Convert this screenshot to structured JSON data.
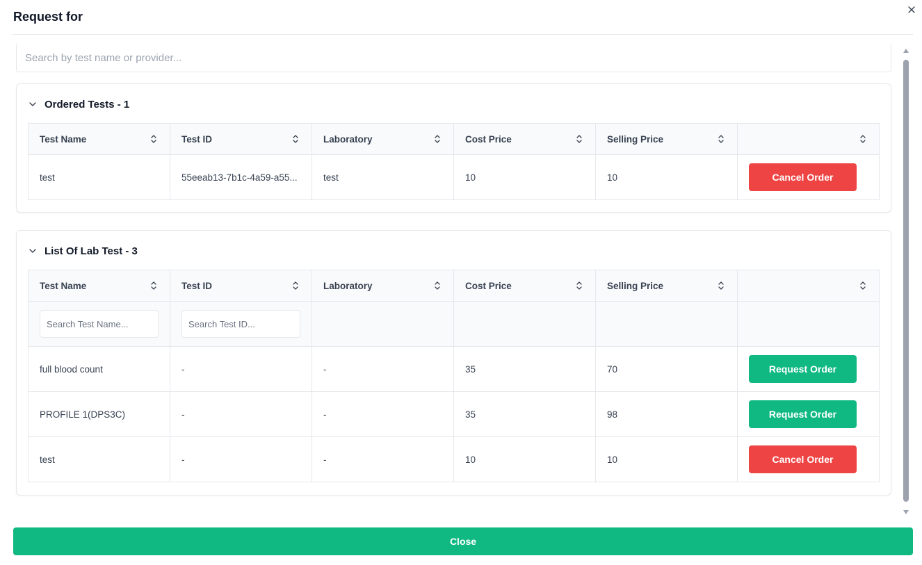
{
  "modal": {
    "title": "Request for",
    "close_label": "Close"
  },
  "search": {
    "placeholder": "Search by test name or provider..."
  },
  "colors": {
    "cancel": "#ef4444",
    "request": "#10b981",
    "close_button": "#10b981"
  },
  "ordered_tests": {
    "title": "Ordered Tests - 1",
    "columns": [
      "Test Name",
      "Test ID",
      "Laboratory",
      "Cost Price",
      "Selling Price",
      ""
    ],
    "rows": [
      {
        "test_name": "test",
        "test_id": "55eeab13-7b1c-4a59-a55...",
        "laboratory": "test",
        "cost_price": "10",
        "selling_price": "10",
        "action": "Cancel Order"
      }
    ]
  },
  "lab_tests": {
    "title": "List Of Lab Test - 3",
    "columns": [
      "Test Name",
      "Test ID",
      "Laboratory",
      "Cost Price",
      "Selling Price",
      ""
    ],
    "filters": {
      "test_name_placeholder": "Search Test Name...",
      "test_id_placeholder": "Search Test ID..."
    },
    "rows": [
      {
        "test_name": "full blood count",
        "test_id": "-",
        "laboratory": "-",
        "cost_price": "35",
        "selling_price": "70",
        "action": "Request Order"
      },
      {
        "test_name": "PROFILE 1(DPS3C)",
        "test_id": "-",
        "laboratory": "-",
        "cost_price": "35",
        "selling_price": "98",
        "action": "Request Order"
      },
      {
        "test_name": "test",
        "test_id": "-",
        "laboratory": "-",
        "cost_price": "10",
        "selling_price": "10",
        "action": "Cancel Order"
      }
    ]
  }
}
